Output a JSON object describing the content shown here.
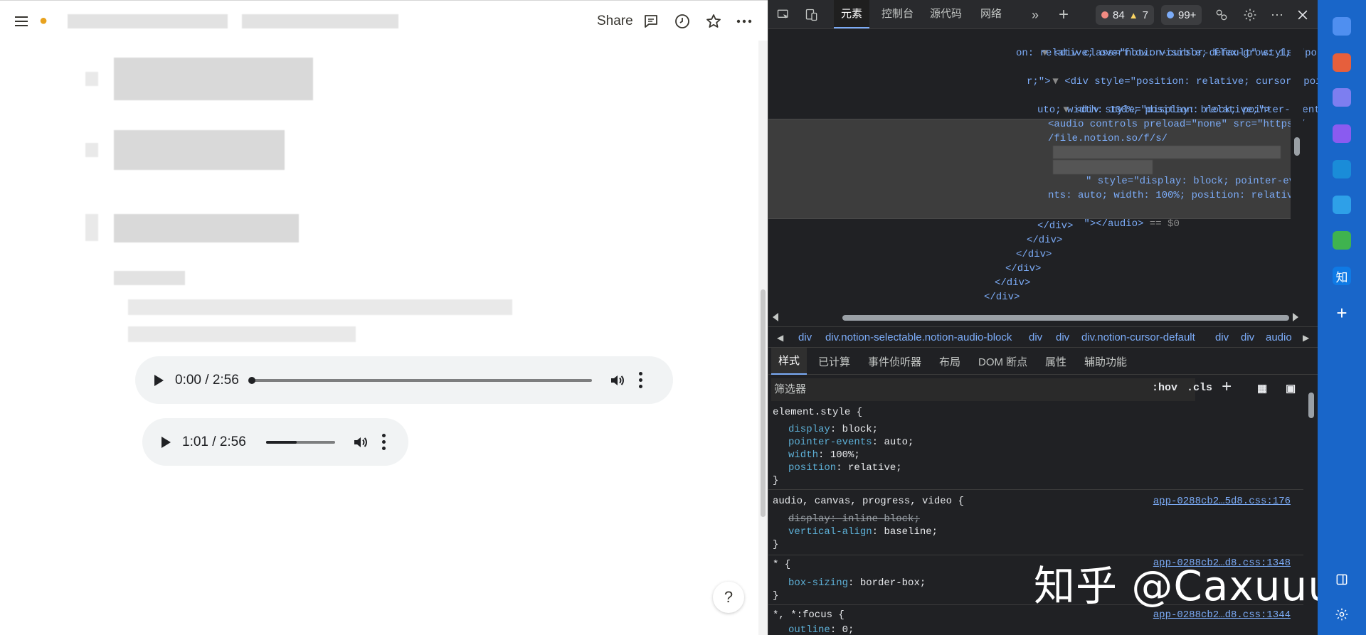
{
  "notion": {
    "share_label": "Share",
    "audio_players": [
      {
        "current_time": "0:00",
        "duration": "2:56",
        "time_label": "0:00 / 2:56",
        "progress": 0.0
      },
      {
        "current_time": "1:01",
        "duration": "2:56",
        "time_label": "1:01 / 2:56",
        "progress": 0.45
      }
    ],
    "help_label": "?"
  },
  "devtools": {
    "tabs": [
      "元素",
      "控制台",
      "源代码",
      "网络"
    ],
    "active_tab": "元素",
    "error_count": "84",
    "warning_count": "7",
    "issue_count": "99+",
    "dom_lines": [
      "<div class=\"notion-cursor-default\" style=\"positi",
      "on: relative; overflow: visible; flex-grow: 1;\">",
      "<div style=\"position: relative; cursor: pointe",
      "r;\">",
      "<div style=\"display: block; pointer-events: a",
      "uto; width: 100%; position: relative;\">",
      "<audio controls preload=\"none\" src=\"https:/",
      "/file.notion.so/f/s/",
      "\" style=\"display: block; pointer-eve",
      "nts: auto; width: 100%; position: relative;",
      "\"></audio>",
      "== $0",
      "</div>",
      "</div>",
      "</div>",
      "</div>",
      "</div>",
      "</div>"
    ],
    "breadcrumbs": [
      "div",
      "div.notion-selectable.notion-audio-block",
      "div",
      "div",
      "div.notion-cursor-default",
      "div",
      "div",
      "audio"
    ],
    "style_tabs": [
      "样式",
      "已计算",
      "事件侦听器",
      "布局",
      "DOM 断点",
      "属性",
      "辅助功能"
    ],
    "active_style_tab": "样式",
    "filter_placeholder": "筛选器",
    "hov_label": ":hov",
    "cls_label": ".cls",
    "rules": {
      "element_selector": "element.style {",
      "element_props": [
        {
          "name": "display",
          "value": "block;"
        },
        {
          "name": "pointer-events",
          "value": "auto;"
        },
        {
          "name": "width",
          "value": "100%;"
        },
        {
          "name": "position",
          "value": "relative;"
        }
      ],
      "audio_selector": "audio, canvas, progress, video {",
      "audio_source": "app-0288cb2…5d8.css:176",
      "audio_props": [
        {
          "name": "display",
          "value": "inline-block;"
        },
        {
          "name": "vertical-align",
          "value": "baseline;"
        }
      ],
      "star_selector": "* {",
      "star_source": "app-0288cb2…d8.css:1348",
      "star_props": [
        {
          "name": "box-sizing",
          "value": "border-box;"
        }
      ],
      "focus_selector": "*, *:focus {",
      "focus_source": "app-0288cb2…d8.css:1344",
      "focus_prop_name": "outline",
      "focus_prop_value": "0;",
      "close_brace": "}"
    }
  },
  "watermark": "知乎 @Caxuuuu",
  "edge_sidebar": {
    "zhihu_label": "知"
  }
}
